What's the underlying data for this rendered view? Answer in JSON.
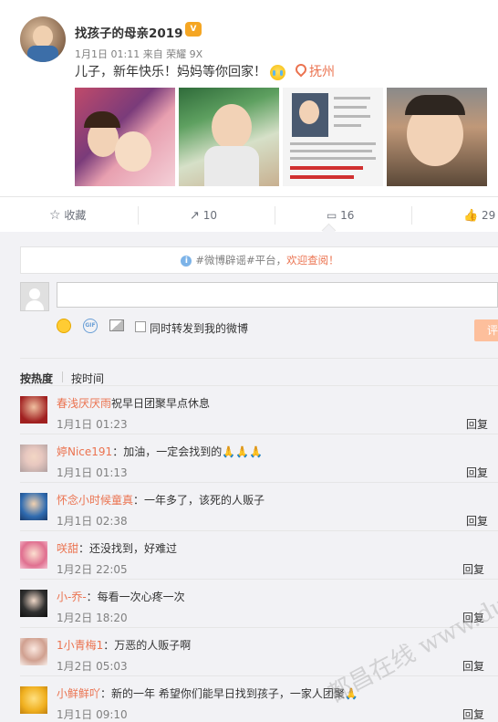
{
  "post": {
    "username": "找孩子的母亲2019",
    "vip_badge": "V",
    "meta": "1月1日 01:11 来自 荣耀 9X",
    "text": "儿子，新年快乐！妈妈等你回家！",
    "location": "抚州"
  },
  "actions": {
    "favorite": "收藏",
    "forward": "10",
    "comment": "16",
    "like": "29"
  },
  "notice": {
    "text": "#微博辟谣#平台，",
    "link": "欢迎查阅！"
  },
  "composer": {
    "also_forward": "同时转发到我的微博",
    "submit": "评"
  },
  "sort": {
    "hot": "按热度",
    "time": "按时间"
  },
  "comments": [
    {
      "name": "春浅厌厌雨",
      "text": "祝早日团聚早点休息",
      "time": "1月1日 01:23",
      "reply": "回复"
    },
    {
      "name": "婷Nice191",
      "text": "：加油，一定会找到的🙏🙏🙏",
      "time": "1月1日 01:13",
      "reply": "回复"
    },
    {
      "name": "怀念小时候童真",
      "text": "：一年多了，该死的人贩子",
      "time": "1月1日 02:38",
      "reply": "回复"
    },
    {
      "name": "咲甜",
      "text": "：还没找到，好难过",
      "time": "1月2日 22:05",
      "reply": "回复"
    },
    {
      "name": "小-乔-",
      "text": "：每看一次心疼一次",
      "time": "1月2日 18:20",
      "reply": "回复"
    },
    {
      "name": "1小青梅1",
      "text": "：万恶的人贩子啊",
      "time": "1月2日 05:03",
      "reply": "回复"
    },
    {
      "name": "小鲜鲜吖",
      "text": "：新的一年 希望你们能早日找到孩子，一家人团聚🙏",
      "time": "1月1日 09:10",
      "reply": "回复"
    }
  ],
  "watermark": "都昌在线 www.duchang.org"
}
